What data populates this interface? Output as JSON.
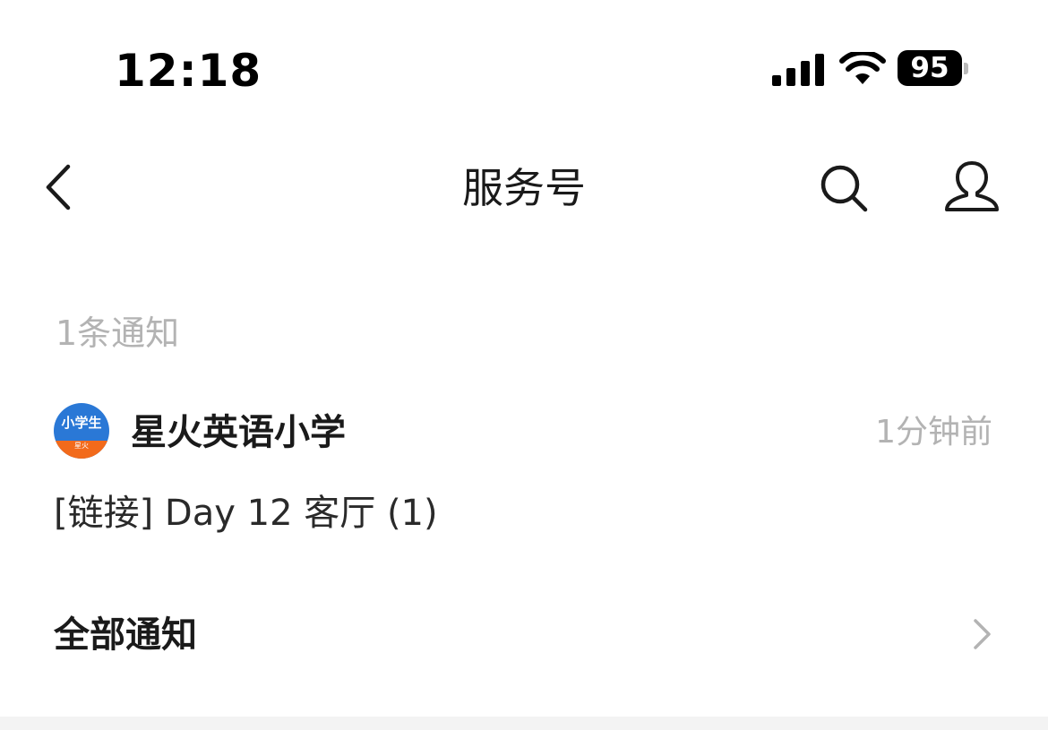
{
  "status_bar": {
    "time": "12:18",
    "battery": "95",
    "icons": [
      "signal-icon",
      "wifi-icon",
      "battery-icon"
    ]
  },
  "nav": {
    "title": "服务号",
    "icons": [
      "chevron-left-icon",
      "search-icon",
      "person-icon"
    ]
  },
  "section_label": "1条通知",
  "notification": {
    "avatar_text": "小学生",
    "avatar_subtext": "星火",
    "sender": "星火英语小学",
    "time_ago": "1分钟前",
    "preview": "[链接] Day 12 客厅 (1)"
  },
  "all_notifications": {
    "label": "全部通知",
    "icon": "chevron-right-icon"
  },
  "colors": {
    "accent_blue": "#2a78d6",
    "accent_orange": "#f26a1b",
    "muted_text": "#b3b3b3"
  }
}
